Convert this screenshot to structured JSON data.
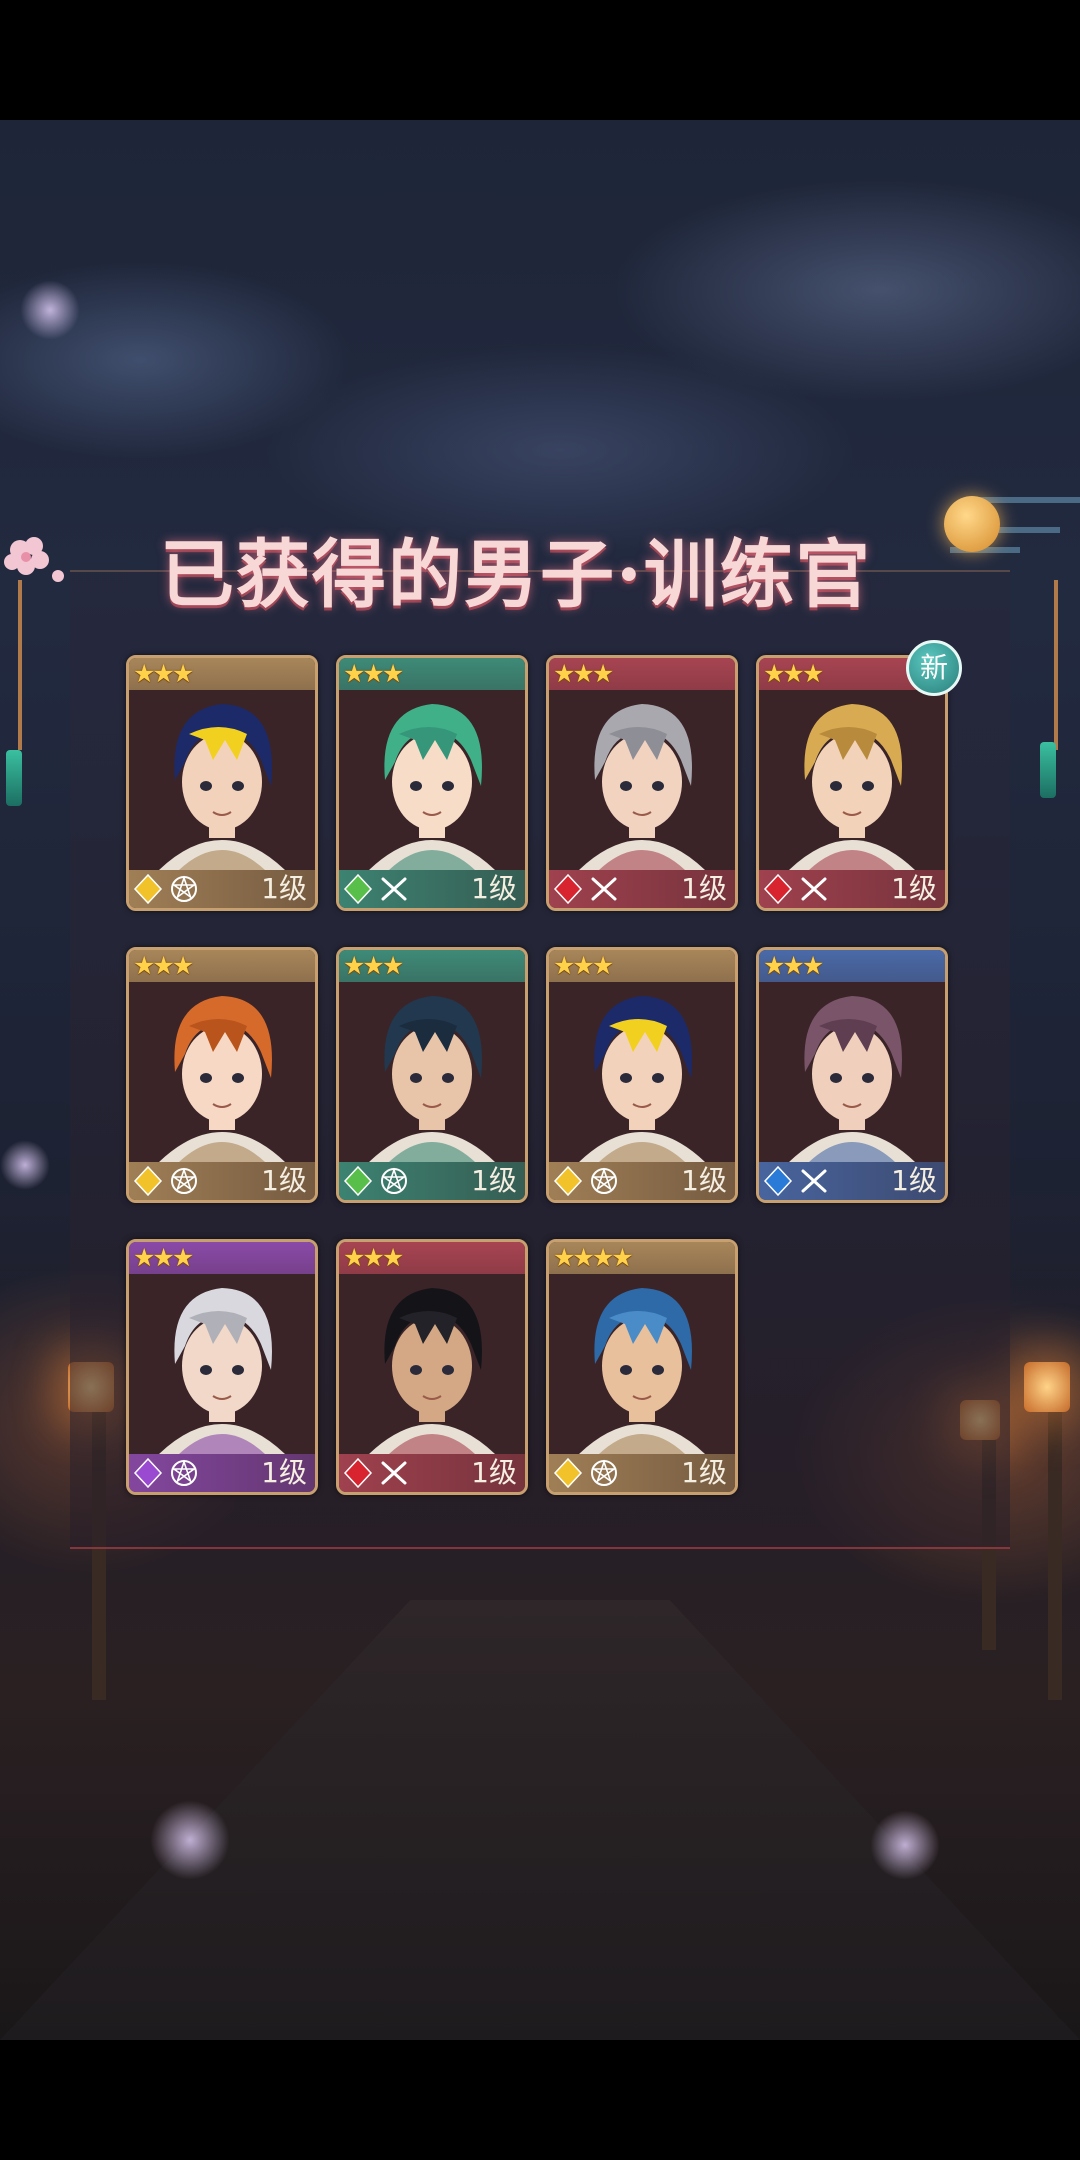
{
  "title": "已获得的男子·训练官",
  "new_badge": "新",
  "cards": [
    {
      "stars": "★★★",
      "element": "gold",
      "role": "pentagram",
      "level": "1级",
      "theme": "#a8865a",
      "hair": "#1c2a6a",
      "hair2": "#f2d020",
      "skin": "#f3d2bc"
    },
    {
      "stars": "★★★",
      "element": "leaf",
      "role": "swords",
      "level": "1级",
      "theme": "#3e8a78",
      "hair": "#3fb088",
      "hair2": "#35967a",
      "skin": "#f7dcc8"
    },
    {
      "stars": "★★★",
      "element": "fire",
      "role": "swords",
      "level": "1级",
      "theme": "#a84452",
      "hair": "#a8a8ae",
      "hair2": "#8e8e96",
      "skin": "#f1d3c0"
    },
    {
      "stars": "★★★",
      "element": "fire",
      "role": "swords",
      "level": "1级",
      "theme": "#a84452",
      "hair": "#d8aa52",
      "hair2": "#b78a3c",
      "skin": "#f2d2b8"
    },
    {
      "stars": "★★★",
      "element": "gold",
      "role": "pentagram",
      "level": "1级",
      "theme": "#a8865a",
      "hair": "#d66a2a",
      "hair2": "#b8541c",
      "skin": "#f6d8c4"
    },
    {
      "stars": "★★★",
      "element": "leaf",
      "role": "pentagram",
      "level": "1级",
      "theme": "#3e8a78",
      "hair": "#22384e",
      "hair2": "#1a2c3e",
      "skin": "#e8c4a8"
    },
    {
      "stars": "★★★",
      "element": "gold",
      "role": "pentagram",
      "level": "1级",
      "theme": "#a8865a",
      "hair": "#1c2a6a",
      "hair2": "#f2d020",
      "skin": "#f3d2bc"
    },
    {
      "stars": "★★★",
      "element": "water",
      "role": "swords",
      "level": "1级",
      "theme": "#4a6aa8",
      "hair": "#7a5468",
      "hair2": "#5e3e50",
      "skin": "#f0d0bc"
    },
    {
      "stars": "★★★",
      "element": "void",
      "role": "pentagram",
      "level": "1级",
      "theme": "#8a4aa8",
      "hair": "#d8d8de",
      "hair2": "#b0b0b8",
      "skin": "#f1d8c8"
    },
    {
      "stars": "★★★",
      "element": "fire",
      "role": "swords",
      "level": "1级",
      "theme": "#a84452",
      "hair": "#141418",
      "hair2": "#222228",
      "skin": "#d4a884"
    },
    {
      "stars": "★★★★",
      "element": "gold",
      "role": "pentagram",
      "level": "1级",
      "theme": "#a8865a",
      "hair": "#2e6aa8",
      "hair2": "#4a8cc8",
      "skin": "#e8c09c"
    }
  ],
  "element_colors": {
    "gold": "#f2c22a",
    "leaf": "#58c04a",
    "fire": "#d8242e",
    "water": "#2a7ad8",
    "void": "#9a4ad0"
  }
}
